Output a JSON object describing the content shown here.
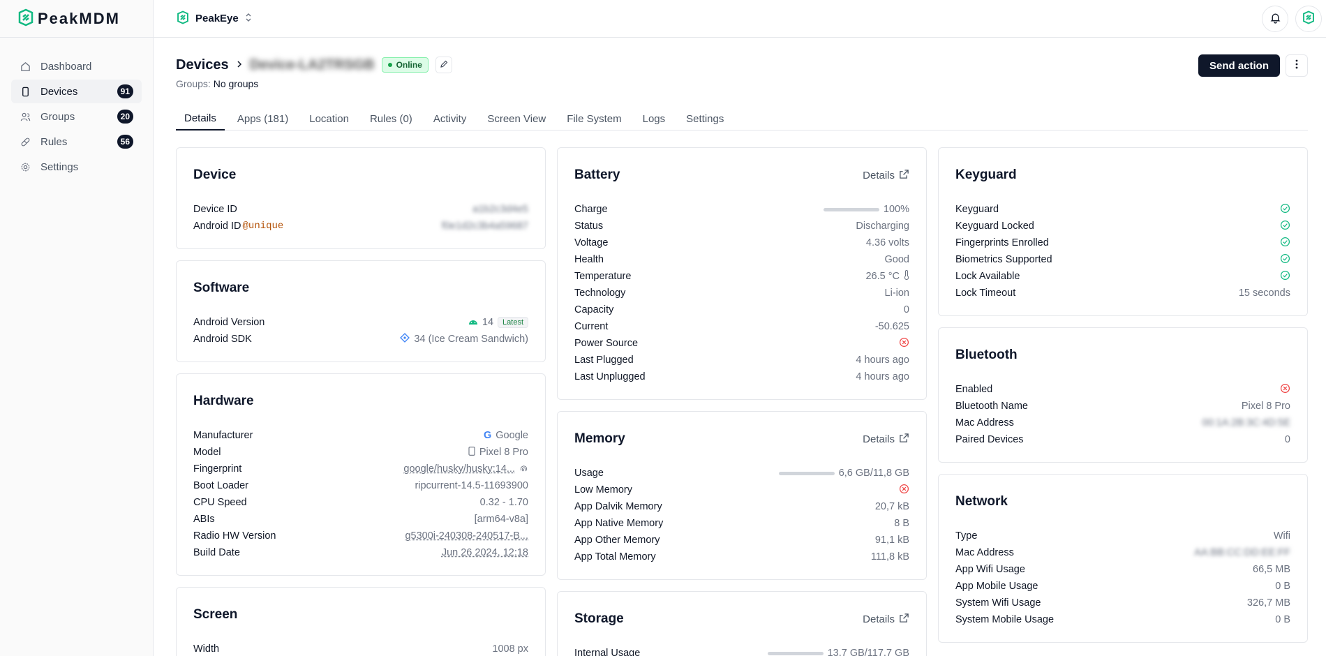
{
  "brand": {
    "name": "PeakMDM"
  },
  "org": {
    "name": "PeakEye"
  },
  "sidebar": {
    "items": [
      {
        "label": "Dashboard",
        "badge": ""
      },
      {
        "label": "Devices",
        "badge": "91"
      },
      {
        "label": "Groups",
        "badge": "20"
      },
      {
        "label": "Rules",
        "badge": "56"
      },
      {
        "label": "Settings",
        "badge": ""
      }
    ]
  },
  "header": {
    "breadcrumb_root": "Devices",
    "device_name": "Device-LA2TRSGB",
    "status": "Online",
    "groups_label": "Groups:",
    "groups_value": "No groups",
    "send_action": "Send action"
  },
  "tabs": [
    "Details",
    "Apps (181)",
    "Location",
    "Rules (0)",
    "Activity",
    "Screen View",
    "File System",
    "Logs",
    "Settings"
  ],
  "device": {
    "title": "Device",
    "device_id_label": "Device ID",
    "device_id_value": "a1b2c3d4e5",
    "android_id_label": "Android ID",
    "android_id_tag": "@unique",
    "android_id_value": "f0e1d2c3b4a59687"
  },
  "software": {
    "title": "Software",
    "android_version_label": "Android Version",
    "android_version_value": "14",
    "android_version_tag": "Latest",
    "sdk_label": "Android SDK",
    "sdk_value": "34 (Ice Cream Sandwich)"
  },
  "hardware": {
    "title": "Hardware",
    "rows": [
      {
        "k": "Manufacturer",
        "v": "Google"
      },
      {
        "k": "Model",
        "v": "Pixel 8 Pro"
      },
      {
        "k": "Fingerprint",
        "v": "google/husky/husky:14..."
      },
      {
        "k": "Boot Loader",
        "v": "ripcurrent-14.5-11693900"
      },
      {
        "k": "CPU Speed",
        "v": "0.32 - 1.70"
      },
      {
        "k": "ABIs",
        "v": "[arm64-v8a]"
      },
      {
        "k": "Radio HW Version",
        "v": "g5300i-240308-240517-B..."
      },
      {
        "k": "Build Date",
        "v": "Jun 26 2024, 12:18"
      }
    ]
  },
  "screen": {
    "title": "Screen",
    "width_label": "Width",
    "width_value": "1008 px"
  },
  "battery": {
    "title": "Battery",
    "details": "Details",
    "charge_label": "Charge",
    "charge_value": "100%",
    "charge_level": 1.0,
    "rows": [
      {
        "k": "Status",
        "v": "Discharging"
      },
      {
        "k": "Voltage",
        "v": "4.36 volts"
      },
      {
        "k": "Health",
        "v": "Good"
      },
      {
        "k": "Temperature",
        "v": "26.5 °C"
      },
      {
        "k": "Technology",
        "v": "Li-ion"
      },
      {
        "k": "Capacity",
        "v": "0"
      },
      {
        "k": "Current",
        "v": "-50.625"
      }
    ],
    "power_source_label": "Power Source",
    "last_plugged_label": "Last Plugged",
    "last_plugged_value": "4 hours ago",
    "last_unplugged_label": "Last Unplugged",
    "last_unplugged_value": "4 hours ago"
  },
  "memory": {
    "title": "Memory",
    "details": "Details",
    "usage_label": "Usage",
    "usage_value": "6,6 GB/11,8 GB",
    "usage_level": 0.56,
    "low_memory_label": "Low Memory",
    "rows": [
      {
        "k": "App Dalvik Memory",
        "v": "20,7 kB"
      },
      {
        "k": "App Native Memory",
        "v": "8 B"
      },
      {
        "k": "App Other Memory",
        "v": "91,1 kB"
      },
      {
        "k": "App Total Memory",
        "v": "111,8 kB"
      }
    ]
  },
  "storage": {
    "title": "Storage",
    "details": "Details",
    "internal_label": "Internal Usage",
    "internal_value": "13,7 GB/117,7 GB",
    "internal_level": 0.12
  },
  "keyguard": {
    "title": "Keyguard",
    "rows": [
      "Keyguard",
      "Keyguard Locked",
      "Fingerprints Enrolled",
      "Biometrics Supported",
      "Lock Available"
    ],
    "lock_timeout_label": "Lock Timeout",
    "lock_timeout_value": "15 seconds"
  },
  "bluetooth": {
    "title": "Bluetooth",
    "enabled_label": "Enabled",
    "name_label": "Bluetooth Name",
    "name_value": "Pixel 8 Pro",
    "mac_label": "Mac Address",
    "mac_value": "00:1A:2B:3C:4D:5E",
    "paired_label": "Paired Devices",
    "paired_value": "0"
  },
  "network": {
    "title": "Network",
    "rows": [
      {
        "k": "Type",
        "v": "Wifi"
      },
      {
        "k": "Mac Address",
        "v": "AA:BB:CC:DD:EE:FF"
      },
      {
        "k": "App Wifi Usage",
        "v": "66,5 MB"
      },
      {
        "k": "App Mobile Usage",
        "v": "0 B"
      },
      {
        "k": "System Wifi Usage",
        "v": "326,7 MB"
      },
      {
        "k": "System Mobile Usage",
        "v": "0 B"
      }
    ]
  },
  "colors": {
    "accent": "#10b981",
    "error": "#ef4444",
    "dark": "#0f172a"
  }
}
